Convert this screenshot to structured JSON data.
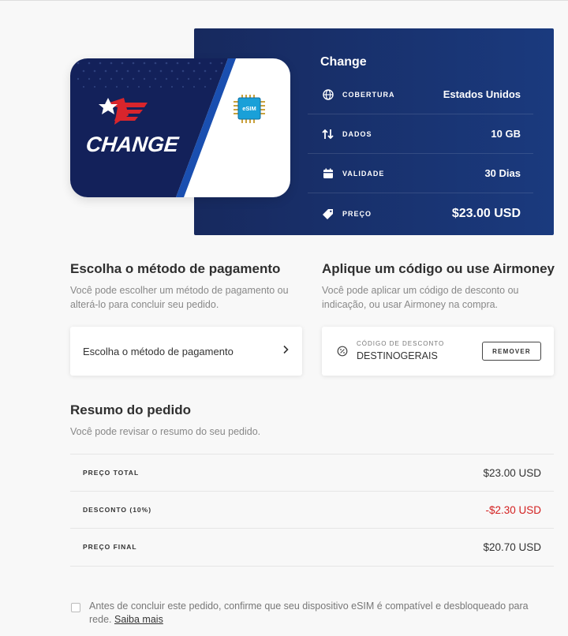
{
  "package": {
    "title": "Change",
    "brand_text": "CHANGE",
    "chip_label": "eSIM",
    "rows": [
      {
        "icon": "globe-icon",
        "label": "COBERTURA",
        "value": "Estados Unidos"
      },
      {
        "icon": "arrows-up-down-icon",
        "label": "DADOS",
        "value": "10 GB"
      },
      {
        "icon": "calendar-icon",
        "label": "VALIDADE",
        "value": "30 Dias"
      },
      {
        "icon": "price-tag-icon",
        "label": "PREÇO",
        "value": "$23.00 USD"
      }
    ],
    "colors": {
      "panel_start": "#17295e",
      "panel_end": "#1a3a7e",
      "card_navy": "#13215a",
      "card_accent": "#1a4fb0",
      "brand_red": "#d8252c"
    }
  },
  "payment": {
    "title": "Escolha o método de pagamento",
    "description": "Você pode escolher um método de pagamento ou alterá-lo para concluir seu pedido.",
    "button_label": "Escolha o método de pagamento"
  },
  "coupon": {
    "title": "Aplique um código ou use Airmoney",
    "description": "Você pode aplicar um código de desconto ou indicação, ou usar Airmoney na compra.",
    "field_label": "CÓDIGO DE DESCONTO",
    "code": "DESTINOGERAIS",
    "remove_label": "REMOVER"
  },
  "summary": {
    "title": "Resumo do pedido",
    "description": "Você pode revisar o resumo do seu pedido.",
    "rows": [
      {
        "label": "PREÇO TOTAL",
        "value": "$23.00 USD"
      },
      {
        "label": "DESCONTO (10%)",
        "value": "-$2.30 USD"
      },
      {
        "label": "PREÇO FINAL",
        "value": "$20.70 USD"
      }
    ]
  },
  "confirm": {
    "text": "Antes de concluir este pedido, confirme que seu dispositivo eSIM é compatível e desbloqueado para rede.",
    "link": "Saiba mais"
  }
}
